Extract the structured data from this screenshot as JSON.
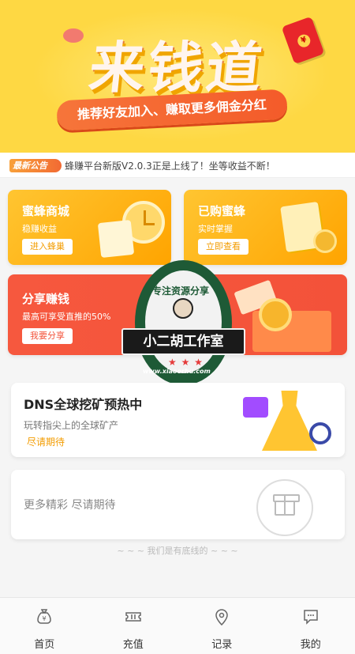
{
  "banner": {
    "title": "来钱道",
    "subtitle": "推荐好友加入、赚取更多佣金分红"
  },
  "notice": {
    "badge": "最新公告",
    "text": "蜂赚平台新版V2.0.3正是上线了！坐等收益不断！"
  },
  "cards": {
    "mall": {
      "title": "蜜蜂商城",
      "desc": "稳赚收益",
      "button": "进入蜂巢"
    },
    "bees": {
      "title": "已购蜜蜂",
      "desc": "实时掌握",
      "button": "立即查看"
    },
    "share": {
      "title": "分享赚钱",
      "desc": "最高可享受直推的50%",
      "button": "我要分享"
    },
    "dns": {
      "title": "DNS全球挖矿预热中",
      "desc": "玩转指尖上的全球矿产",
      "button": "尽请期待"
    },
    "more": {
      "text": "更多精彩 尽请期待"
    }
  },
  "footer_line": "~ ~ ~ 我们是有底线的 ~ ~ ~",
  "watermark": {
    "top_text": "专注资源分享",
    "name": "小二胡工作室",
    "url": "www.xiaoerhu.com",
    "stars": "★ ★ ★"
  },
  "tabbar": [
    {
      "label": "首页",
      "icon": "money-bag-icon"
    },
    {
      "label": "充值",
      "icon": "ticket-icon"
    },
    {
      "label": "记录",
      "icon": "location-pin-icon"
    },
    {
      "label": "我的",
      "icon": "chat-bubble-icon"
    }
  ],
  "colors": {
    "banner_bg": "#fed843",
    "card_yellow": "#ffb316",
    "card_red": "#f35239",
    "accent_orange": "#f39c00"
  }
}
